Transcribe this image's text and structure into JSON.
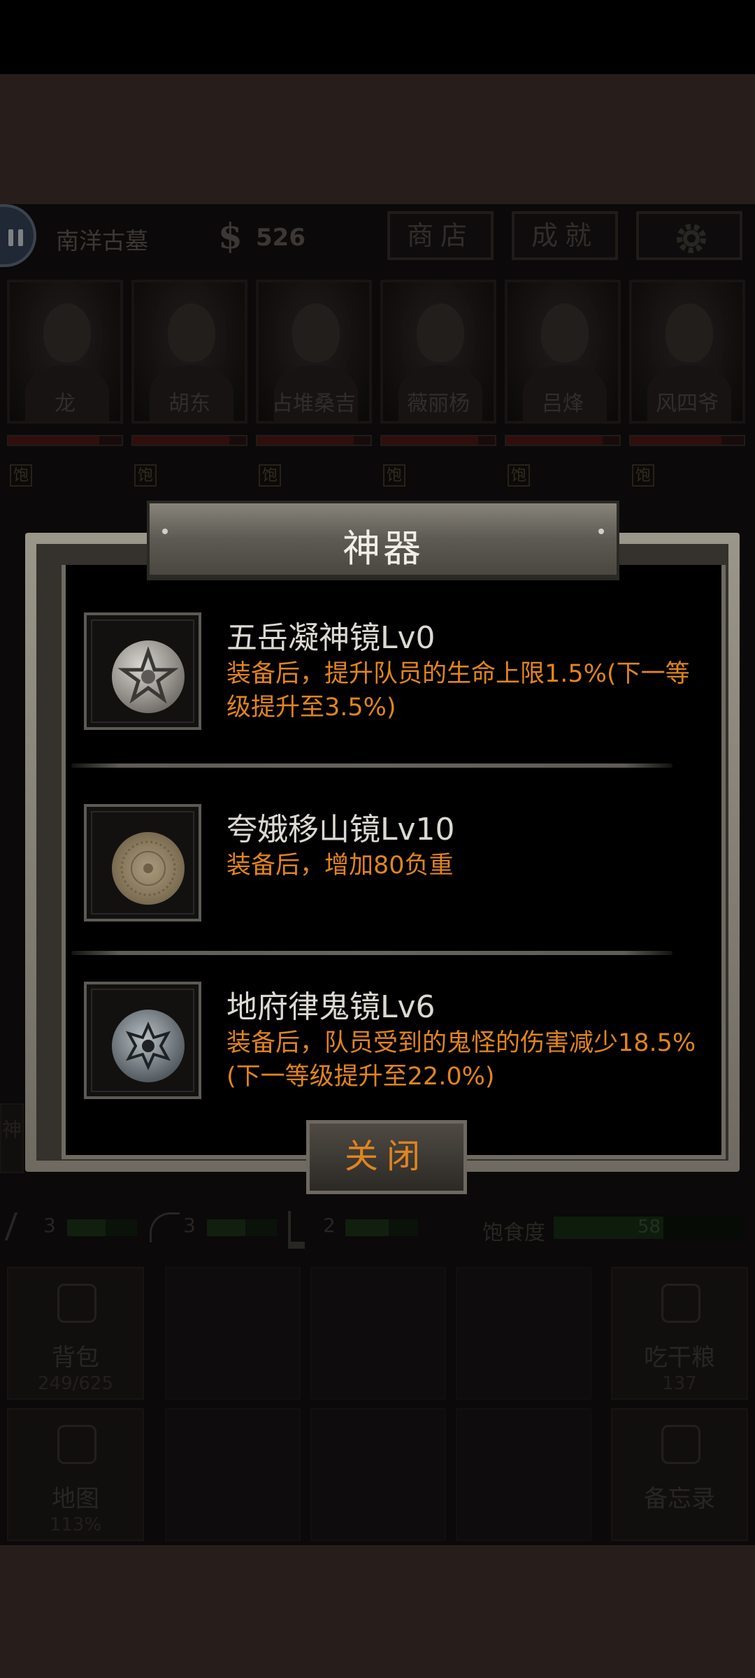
{
  "status": {
    "location": "南洋古墓",
    "currency_symbol": "$",
    "money": "526",
    "shop_label": "商店",
    "achievements_label": "成就"
  },
  "characters": [
    {
      "name": "龙",
      "hp": 0.8
    },
    {
      "name": "胡东",
      "hp": 0.85
    },
    {
      "name": "占堆桑吉",
      "hp": 0.85
    },
    {
      "name": "薇丽杨",
      "hp": 0.85
    },
    {
      "name": "吕烽",
      "hp": 0.85
    },
    {
      "name": "风四爷",
      "hp": 0.8
    }
  ],
  "satiety_badge": "饱",
  "side_tab_label": "神",
  "resources": [
    {
      "icon": "pickaxe-icon",
      "count": "3"
    },
    {
      "icon": "rope-icon",
      "count": "3"
    },
    {
      "icon": "shovel-icon",
      "count": "2"
    }
  ],
  "satiety": {
    "label": "饱食度",
    "value": "58"
  },
  "menu": {
    "backpack": {
      "label": "背包",
      "sub": "249/625"
    },
    "eat": {
      "label": "吃干粮",
      "sub": "137"
    },
    "map": {
      "label": "地图",
      "sub": "113%"
    },
    "memo": {
      "label": "备忘录"
    }
  },
  "dialog": {
    "title": "神器",
    "items": [
      {
        "name": "五岳凝神镜Lv0",
        "desc": "装备后，提升队员的生命上限1.5%(下一等级提升至3.5%)",
        "icon": "pentagram-mirror-icon"
      },
      {
        "name": "夸娥移山镜Lv10",
        "desc": "装备后，增加80负重",
        "icon": "bronze-mirror-icon"
      },
      {
        "name": "地府律鬼镜Lv6",
        "desc": "装备后，队员受到的鬼怪的伤害减少18.5%(下一等级提升至22.0%)",
        "icon": "silver-mirror-icon"
      }
    ],
    "close_label": "关闭"
  },
  "colors": {
    "accent_orange": "#e0851e",
    "dialog_bg": "#000000",
    "frame_stone": "#8f8a80"
  }
}
